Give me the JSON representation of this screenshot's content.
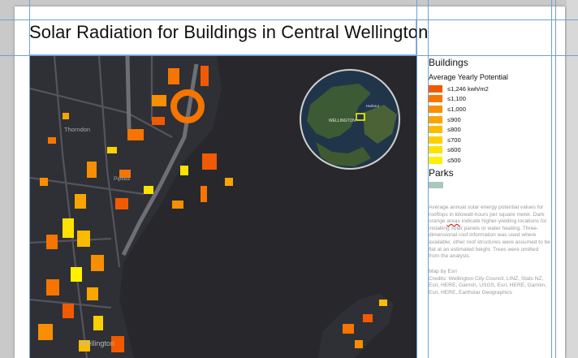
{
  "title": "Solar Radiation for Buildings in Central Wellington",
  "legend": {
    "heading": "Buildings",
    "subheading": "Average Yearly Potential",
    "classes": [
      {
        "label": "≤1,246 kwh/m2",
        "color": "#f25a00"
      },
      {
        "label": "≤1,100",
        "color": "#f57500"
      },
      {
        "label": "≤1,000",
        "color": "#f78f00"
      },
      {
        "label": "≤900",
        "color": "#f9a500"
      },
      {
        "label": "≤800",
        "color": "#fbbb00"
      },
      {
        "label": "≤700",
        "color": "#fcd000"
      },
      {
        "label": "≤600",
        "color": "#fde200"
      },
      {
        "label": "≤500",
        "color": "#fff100"
      }
    ],
    "parks_heading": "Parks",
    "parks_color": "#a8c8c0"
  },
  "description": {
    "before": "Average annual solar energy potential values for rooftops in kilowatt-hours per square meter. Dark orange",
    "squiggle": "areas",
    "after": "indicate higher-yielding locations for installing solar panels or water heating. Three-dimensional roof information was used where available; other roof structures were assumed to be flat at an estimated height. Trees were omitted from the analysis."
  },
  "credits": {
    "map_by": "Map by Esri",
    "text": "Credits: Wellington City Council, LINZ, Stats NZ, Esri, HERE, Garmin, USGS, Esri, HERE, Garmin, Esri, HERE, Earthstar Geographics"
  },
  "map": {
    "labels": {
      "thorndon": "Thorndon",
      "pipitea": "Pipitea",
      "wellington": "Wellington",
      "inset_wellington": "WELLINGTON",
      "inset_harbour": "Harbour"
    }
  }
}
